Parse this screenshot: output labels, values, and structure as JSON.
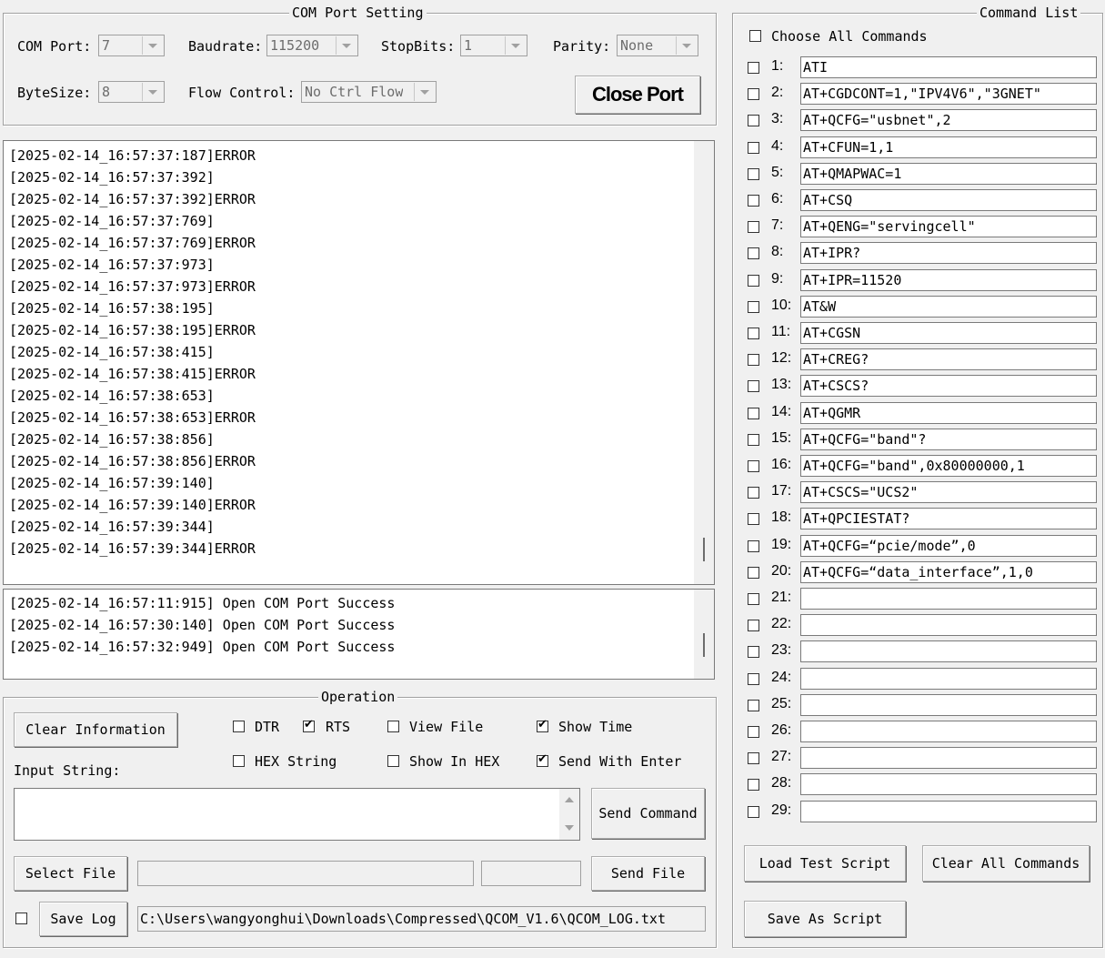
{
  "com_port_setting": {
    "title": "COM Port Setting",
    "com_port_label": "COM Port:",
    "com_port_value": "7",
    "baudrate_label": "Baudrate:",
    "baudrate_value": "115200",
    "stopbits_label": "StopBits:",
    "stopbits_value": "1",
    "parity_label": "Parity:",
    "parity_value": "None",
    "bytesize_label": "ByteSize:",
    "bytesize_value": "8",
    "flow_label": "Flow Control:",
    "flow_value": "No Ctrl Flow",
    "close_port_label": "Close Port"
  },
  "receive_log": [
    "[2025-02-14_16:57:37:187]ERROR",
    "[2025-02-14_16:57:37:392]",
    "[2025-02-14_16:57:37:392]ERROR",
    "[2025-02-14_16:57:37:769]",
    "[2025-02-14_16:57:37:769]ERROR",
    "[2025-02-14_16:57:37:973]",
    "[2025-02-14_16:57:37:973]ERROR",
    "[2025-02-14_16:57:38:195]",
    "[2025-02-14_16:57:38:195]ERROR",
    "[2025-02-14_16:57:38:415]",
    "[2025-02-14_16:57:38:415]ERROR",
    "[2025-02-14_16:57:38:653]",
    "[2025-02-14_16:57:38:653]ERROR",
    "[2025-02-14_16:57:38:856]",
    "[2025-02-14_16:57:38:856]ERROR",
    "[2025-02-14_16:57:39:140]",
    "[2025-02-14_16:57:39:140]ERROR",
    "[2025-02-14_16:57:39:344]",
    "[2025-02-14_16:57:39:344]ERROR"
  ],
  "status_log": [
    "[2025-02-14_16:57:11:915] Open COM Port Success",
    "[2025-02-14_16:57:30:140] Open COM Port Success",
    "[2025-02-14_16:57:32:949] Open COM Port Success"
  ],
  "operation": {
    "title": "Operation",
    "clear_info_label": "Clear Information",
    "dtr": {
      "label": "DTR",
      "checked": false
    },
    "rts": {
      "label": "RTS",
      "checked": true
    },
    "view_file": {
      "label": "View File",
      "checked": false
    },
    "show_time": {
      "label": "Show Time",
      "checked": true
    },
    "hex_string": {
      "label": "HEX String",
      "checked": false
    },
    "show_in_hex": {
      "label": "Show In HEX",
      "checked": false
    },
    "send_with_enter": {
      "label": "Send With Enter",
      "checked": true
    },
    "input_string_label": "Input String:",
    "input_value": "",
    "send_command_label": "Send Command",
    "select_file_label": "Select File",
    "file_path_value": "",
    "file_size_value": "",
    "send_file_label": "Send File",
    "save_log_checked": false,
    "save_log_label": "Save Log",
    "log_path": "C:\\Users\\wangyonghui\\Downloads\\Compressed\\QCOM_V1.6\\QCOM_LOG.txt"
  },
  "command_list": {
    "title": "Command List",
    "choose_all_label": "Choose All Commands",
    "commands": [
      {
        "num": "1:",
        "value": "ATI"
      },
      {
        "num": "2:",
        "value": "AT+CGDCONT=1,\"IPV4V6\",\"3GNET\""
      },
      {
        "num": "3:",
        "value": "AT+QCFG=\"usbnet\",2"
      },
      {
        "num": "4:",
        "value": "AT+CFUN=1,1"
      },
      {
        "num": "5:",
        "value": "AT+QMAPWAC=1"
      },
      {
        "num": "6:",
        "value": "AT+CSQ"
      },
      {
        "num": "7:",
        "value": "AT+QENG=\"servingcell\""
      },
      {
        "num": "8:",
        "value": "AT+IPR?"
      },
      {
        "num": "9:",
        "value": "AT+IPR=11520"
      },
      {
        "num": "10:",
        "value": "AT&W"
      },
      {
        "num": "11:",
        "value": "AT+CGSN"
      },
      {
        "num": "12:",
        "value": "AT+CREG?"
      },
      {
        "num": "13:",
        "value": "AT+CSCS?"
      },
      {
        "num": "14:",
        "value": "AT+QGMR"
      },
      {
        "num": "15:",
        "value": "AT+QCFG=\"band\"?"
      },
      {
        "num": "16:",
        "value": "AT+QCFG=\"band\",0x80000000,1"
      },
      {
        "num": "17:",
        "value": "AT+CSCS=\"UCS2\""
      },
      {
        "num": "18:",
        "value": "AT+QPCIESTAT?"
      },
      {
        "num": "19:",
        "value": "AT+QCFG=“pcie/mode”,0"
      },
      {
        "num": "20:",
        "value": "AT+QCFG=“data_interface”,1,0"
      },
      {
        "num": "21:",
        "value": ""
      },
      {
        "num": "22:",
        "value": ""
      },
      {
        "num": "23:",
        "value": ""
      },
      {
        "num": "24:",
        "value": ""
      },
      {
        "num": "25:",
        "value": ""
      },
      {
        "num": "26:",
        "value": ""
      },
      {
        "num": "27:",
        "value": ""
      },
      {
        "num": "28:",
        "value": ""
      },
      {
        "num": "29:",
        "value": ""
      }
    ],
    "load_script_label": "Load Test Script",
    "clear_all_label": "Clear All Commands",
    "save_script_label": "Save As Script"
  }
}
